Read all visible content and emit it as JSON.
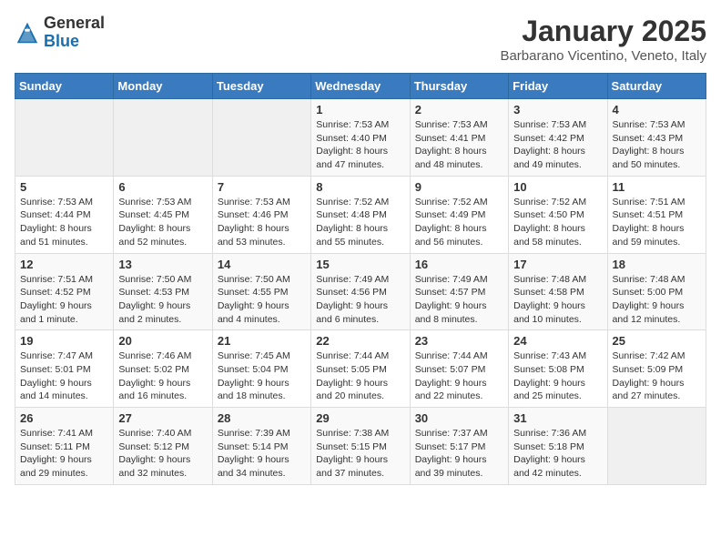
{
  "header": {
    "logo_line1": "General",
    "logo_line2": "Blue",
    "month_title": "January 2025",
    "location": "Barbarano Vicentino, Veneto, Italy"
  },
  "weekdays": [
    "Sunday",
    "Monday",
    "Tuesday",
    "Wednesday",
    "Thursday",
    "Friday",
    "Saturday"
  ],
  "weeks": [
    [
      {
        "day": "",
        "info": ""
      },
      {
        "day": "",
        "info": ""
      },
      {
        "day": "",
        "info": ""
      },
      {
        "day": "1",
        "info": "Sunrise: 7:53 AM\nSunset: 4:40 PM\nDaylight: 8 hours\nand 47 minutes."
      },
      {
        "day": "2",
        "info": "Sunrise: 7:53 AM\nSunset: 4:41 PM\nDaylight: 8 hours\nand 48 minutes."
      },
      {
        "day": "3",
        "info": "Sunrise: 7:53 AM\nSunset: 4:42 PM\nDaylight: 8 hours\nand 49 minutes."
      },
      {
        "day": "4",
        "info": "Sunrise: 7:53 AM\nSunset: 4:43 PM\nDaylight: 8 hours\nand 50 minutes."
      }
    ],
    [
      {
        "day": "5",
        "info": "Sunrise: 7:53 AM\nSunset: 4:44 PM\nDaylight: 8 hours\nand 51 minutes."
      },
      {
        "day": "6",
        "info": "Sunrise: 7:53 AM\nSunset: 4:45 PM\nDaylight: 8 hours\nand 52 minutes."
      },
      {
        "day": "7",
        "info": "Sunrise: 7:53 AM\nSunset: 4:46 PM\nDaylight: 8 hours\nand 53 minutes."
      },
      {
        "day": "8",
        "info": "Sunrise: 7:52 AM\nSunset: 4:48 PM\nDaylight: 8 hours\nand 55 minutes."
      },
      {
        "day": "9",
        "info": "Sunrise: 7:52 AM\nSunset: 4:49 PM\nDaylight: 8 hours\nand 56 minutes."
      },
      {
        "day": "10",
        "info": "Sunrise: 7:52 AM\nSunset: 4:50 PM\nDaylight: 8 hours\nand 58 minutes."
      },
      {
        "day": "11",
        "info": "Sunrise: 7:51 AM\nSunset: 4:51 PM\nDaylight: 8 hours\nand 59 minutes."
      }
    ],
    [
      {
        "day": "12",
        "info": "Sunrise: 7:51 AM\nSunset: 4:52 PM\nDaylight: 9 hours\nand 1 minute."
      },
      {
        "day": "13",
        "info": "Sunrise: 7:50 AM\nSunset: 4:53 PM\nDaylight: 9 hours\nand 2 minutes."
      },
      {
        "day": "14",
        "info": "Sunrise: 7:50 AM\nSunset: 4:55 PM\nDaylight: 9 hours\nand 4 minutes."
      },
      {
        "day": "15",
        "info": "Sunrise: 7:49 AM\nSunset: 4:56 PM\nDaylight: 9 hours\nand 6 minutes."
      },
      {
        "day": "16",
        "info": "Sunrise: 7:49 AM\nSunset: 4:57 PM\nDaylight: 9 hours\nand 8 minutes."
      },
      {
        "day": "17",
        "info": "Sunrise: 7:48 AM\nSunset: 4:58 PM\nDaylight: 9 hours\nand 10 minutes."
      },
      {
        "day": "18",
        "info": "Sunrise: 7:48 AM\nSunset: 5:00 PM\nDaylight: 9 hours\nand 12 minutes."
      }
    ],
    [
      {
        "day": "19",
        "info": "Sunrise: 7:47 AM\nSunset: 5:01 PM\nDaylight: 9 hours\nand 14 minutes."
      },
      {
        "day": "20",
        "info": "Sunrise: 7:46 AM\nSunset: 5:02 PM\nDaylight: 9 hours\nand 16 minutes."
      },
      {
        "day": "21",
        "info": "Sunrise: 7:45 AM\nSunset: 5:04 PM\nDaylight: 9 hours\nand 18 minutes."
      },
      {
        "day": "22",
        "info": "Sunrise: 7:44 AM\nSunset: 5:05 PM\nDaylight: 9 hours\nand 20 minutes."
      },
      {
        "day": "23",
        "info": "Sunrise: 7:44 AM\nSunset: 5:07 PM\nDaylight: 9 hours\nand 22 minutes."
      },
      {
        "day": "24",
        "info": "Sunrise: 7:43 AM\nSunset: 5:08 PM\nDaylight: 9 hours\nand 25 minutes."
      },
      {
        "day": "25",
        "info": "Sunrise: 7:42 AM\nSunset: 5:09 PM\nDaylight: 9 hours\nand 27 minutes."
      }
    ],
    [
      {
        "day": "26",
        "info": "Sunrise: 7:41 AM\nSunset: 5:11 PM\nDaylight: 9 hours\nand 29 minutes."
      },
      {
        "day": "27",
        "info": "Sunrise: 7:40 AM\nSunset: 5:12 PM\nDaylight: 9 hours\nand 32 minutes."
      },
      {
        "day": "28",
        "info": "Sunrise: 7:39 AM\nSunset: 5:14 PM\nDaylight: 9 hours\nand 34 minutes."
      },
      {
        "day": "29",
        "info": "Sunrise: 7:38 AM\nSunset: 5:15 PM\nDaylight: 9 hours\nand 37 minutes."
      },
      {
        "day": "30",
        "info": "Sunrise: 7:37 AM\nSunset: 5:17 PM\nDaylight: 9 hours\nand 39 minutes."
      },
      {
        "day": "31",
        "info": "Sunrise: 7:36 AM\nSunset: 5:18 PM\nDaylight: 9 hours\nand 42 minutes."
      },
      {
        "day": "",
        "info": ""
      }
    ]
  ]
}
